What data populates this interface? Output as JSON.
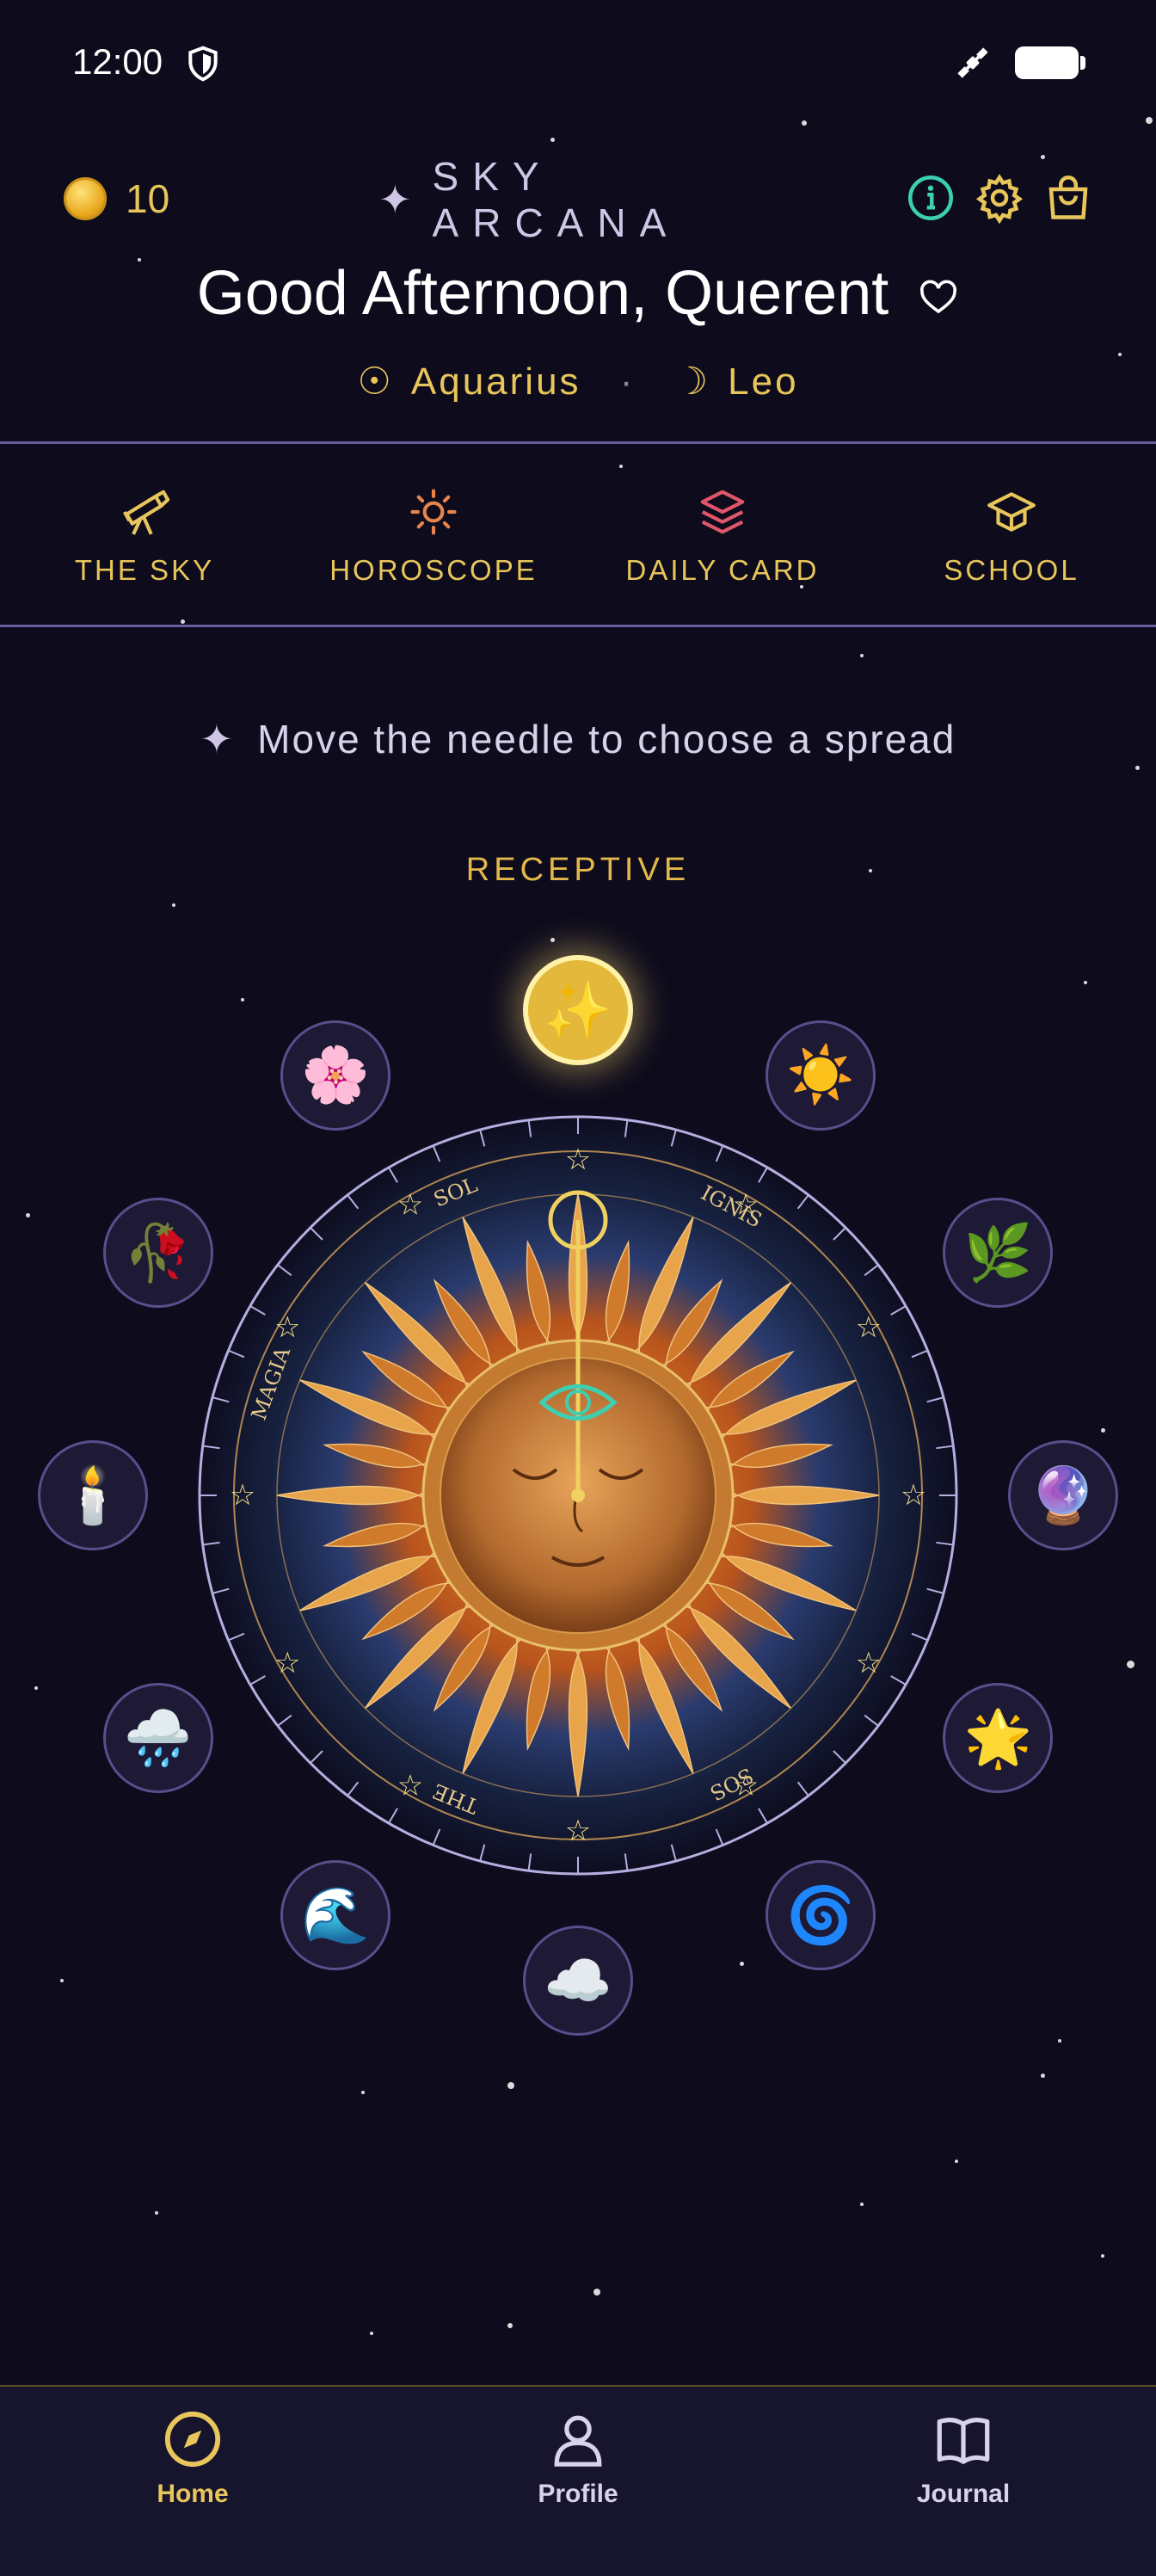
{
  "status_bar": {
    "time": "12:00"
  },
  "header": {
    "coins": "10",
    "brand_star": "✦",
    "brand": "SKY ARCANA",
    "greeting": "Good Afternoon, Querent",
    "sun_glyph": "☉",
    "sun_sign": "Aquarius",
    "separator": "·",
    "moon_glyph": "☽",
    "moon_sign": "Leo"
  },
  "tabs": [
    {
      "label": "THE SKY",
      "icon": "telescope-icon",
      "color": "#e8c65b"
    },
    {
      "label": "HOROSCOPE",
      "icon": "sun-icon",
      "color": "#e8834a"
    },
    {
      "label": "DAILY CARD",
      "icon": "layers-icon",
      "color": "#e0566a"
    },
    {
      "label": "SCHOOL",
      "icon": "graduation-cap-icon",
      "color": "#e8c65b"
    }
  ],
  "hint": {
    "spark": "✦",
    "text": "Move the needle to choose a spread"
  },
  "spread_mode": "RECEPTIVE",
  "orbit_options": [
    {
      "name": "sparkles",
      "emoji": "✨",
      "selected": true
    },
    {
      "name": "sun",
      "emoji": "☀️"
    },
    {
      "name": "herb",
      "emoji": "🌿"
    },
    {
      "name": "crystal-ball",
      "emoji": "🔮"
    },
    {
      "name": "star",
      "emoji": "🌟"
    },
    {
      "name": "cyclone",
      "emoji": "🌀"
    },
    {
      "name": "cloud",
      "emoji": "☁️"
    },
    {
      "name": "wave",
      "emoji": "🌊"
    },
    {
      "name": "rain-cloud",
      "emoji": "🌧️"
    },
    {
      "name": "candle",
      "emoji": "🕯️"
    },
    {
      "name": "wilted-rose",
      "emoji": "🥀"
    },
    {
      "name": "cherry-blossom",
      "emoji": "🌸"
    }
  ],
  "wheel": {
    "labels": [
      "SOL",
      "IGNIS",
      "MAGIA",
      "THE",
      "SOS"
    ]
  },
  "bottom_nav": [
    {
      "label": "Home",
      "icon": "compass-icon",
      "active": true
    },
    {
      "label": "Profile",
      "icon": "person-icon",
      "active": false
    },
    {
      "label": "Journal",
      "icon": "book-icon",
      "active": false
    }
  ],
  "colors": {
    "background": "#0d0b1c",
    "gold": "#e8c65b",
    "lavender": "#cfc6e6",
    "teal": "#3ecfb2"
  }
}
